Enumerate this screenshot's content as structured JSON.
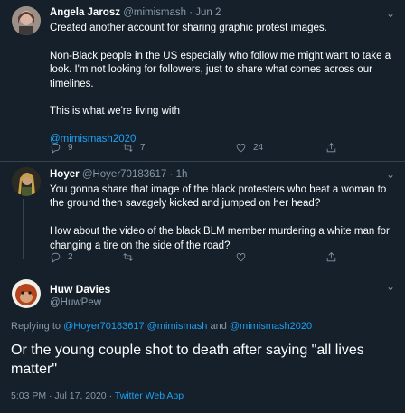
{
  "tweets": [
    {
      "name": "Angela Jarosz",
      "handle": "@mimismash",
      "sep": "·",
      "date": "Jun 2",
      "paragraphs": [
        "Created another account for sharing graphic protest images.",
        "Non-Black people in the US especially who follow me might want to take a look. I'm not looking for followers, just to share what comes across our timelines.",
        "This is what we're living with"
      ],
      "mention": "@mimismash2020",
      "replies": "9",
      "retweets": "7",
      "likes": "24"
    },
    {
      "name": "Hoyer",
      "handle": "@Hoyer70183617",
      "sep": "·",
      "date": "1h",
      "paragraphs": [
        "You gonna share that image of the black protesters who beat a woman to the ground then savagely kicked and jumped on her head?",
        "How about the video of the black BLM member murdering a white man for changing a tire on the side of the road?"
      ],
      "replies": "2"
    }
  ],
  "main": {
    "name": "Huw Davies",
    "handle": "@HuwPew",
    "replying_prefix": "Replying to",
    "replying_to_1": "@Hoyer70183617",
    "replying_to_2": "@mimismash",
    "replying_and": "and",
    "replying_to_3": "@mimismash2020",
    "text": "Or the young couple shot to death after saying \"all lives matter\"",
    "timestamp": "5:03 PM · Jul 17, 2020 ·",
    "client": "Twitter Web App"
  },
  "colors": {
    "background": "#15202b",
    "link": "#1da1f2",
    "muted": "#8899a6",
    "divider": "#38444d"
  },
  "icons": [
    "reply-icon",
    "retweet-icon",
    "like-icon",
    "share-icon",
    "more-icon"
  ]
}
